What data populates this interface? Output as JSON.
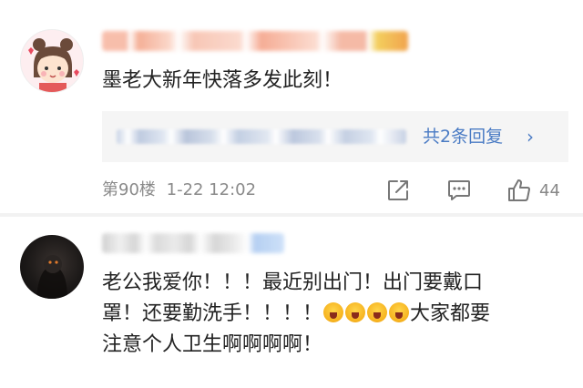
{
  "comments": [
    {
      "text": "墨老大新年快落多发此刻！",
      "reply_link": "共2条回复",
      "floor": "第90楼",
      "time": "1-22 12:02",
      "likes": "44"
    },
    {
      "text_line1": "老公我爱你！！！最近别出门！出门要戴口",
      "text_line2_a": "罩！还要勤洗手！！！！",
      "text_line2_b": "大家都要",
      "text_line3": "注意个人卫生啊啊啊啊！",
      "emoji_name": "crying-face-icon",
      "emoji_count": 4
    }
  ],
  "icons": {
    "share": "share-icon",
    "comment": "comment-icon",
    "like": "thumb-up-icon",
    "reply_more": "chevron-right-icon"
  },
  "colors": {
    "link": "#4a7bc4",
    "meta": "#8a8a8a",
    "reply_bg": "#f5f5f5"
  }
}
